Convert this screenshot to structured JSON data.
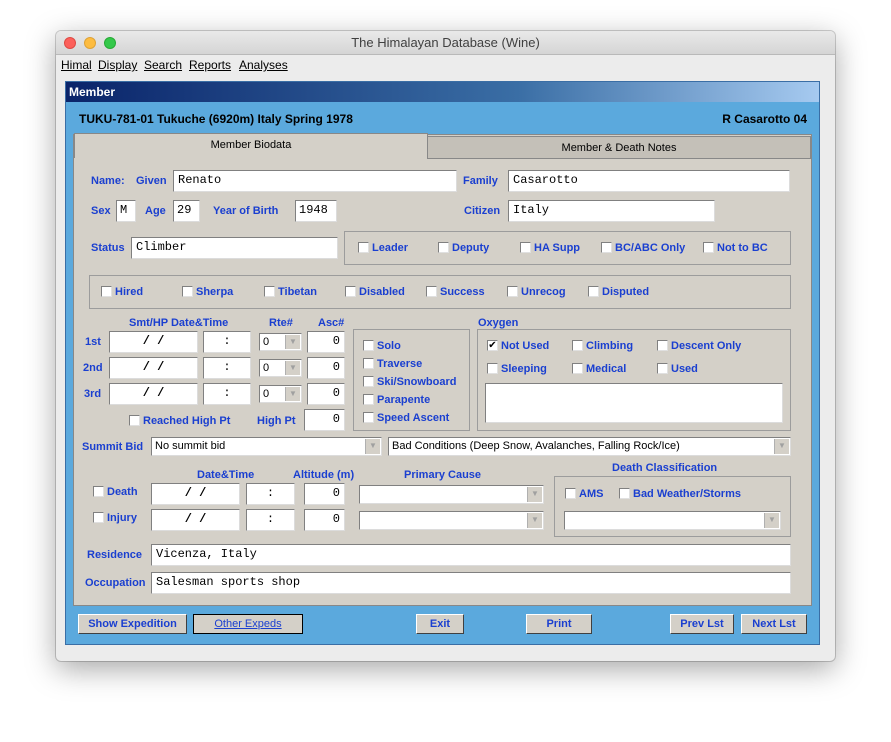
{
  "window": {
    "title": "The Himalayan Database  (Wine)"
  },
  "menu": [
    "Himal",
    "Display",
    "Search",
    "Reports",
    "Analyses"
  ],
  "member_window": {
    "caption": "Member",
    "expedition_info": "TUKU-781-01  Tukuche (6920m)    Italy   Spring 1978",
    "member_ref": "R Casarotto  04",
    "tabs": [
      "Member Biodata",
      "Member & Death Notes"
    ]
  },
  "biodata": {
    "name_label": "Name:",
    "given_label": "Given",
    "given": "Renato",
    "family_label": "Family",
    "family": "Casarotto",
    "sex_label": "Sex",
    "sex": "M",
    "age_label": "Age",
    "age": "29",
    "yob_label": "Year of Birth",
    "yob": "1948",
    "citizen_label": "Citizen",
    "citizen": "Italy",
    "status_label": "Status",
    "status": "Climber"
  },
  "roles": [
    {
      "label": "Leader",
      "checked": ""
    },
    {
      "label": "Deputy",
      "checked": ""
    },
    {
      "label": "HA Supp",
      "checked": ""
    },
    {
      "label": "BC/ABC Only",
      "checked": ""
    },
    {
      "label": "Not to BC",
      "checked": ""
    }
  ],
  "flags": [
    {
      "label": "Hired",
      "checked": ""
    },
    {
      "label": "Sherpa",
      "checked": ""
    },
    {
      "label": "Tibetan",
      "checked": ""
    },
    {
      "label": "Disabled",
      "checked": ""
    },
    {
      "label": "Success",
      "checked": ""
    },
    {
      "label": "Unrecog",
      "checked": ""
    },
    {
      "label": "Disputed",
      "checked": ""
    }
  ],
  "summits": {
    "header_date": "Smt/HP Date&Time",
    "header_rte": "Rte#",
    "header_asc": "Asc#",
    "rows": [
      {
        "label": "1st",
        "date": "  /  /",
        "time": ":",
        "rte": "0",
        "asc": "0"
      },
      {
        "label": "2nd",
        "date": "  /  /",
        "time": ":",
        "rte": "0",
        "asc": "0"
      },
      {
        "label": "3rd",
        "date": "  /  /",
        "time": ":",
        "rte": "0",
        "asc": "0"
      }
    ],
    "reached_high_pt": "Reached High Pt",
    "high_pt_label": "High Pt",
    "high_pt": "0"
  },
  "styles": [
    {
      "label": "Solo",
      "checked": ""
    },
    {
      "label": "Traverse",
      "checked": ""
    },
    {
      "label": "Ski/Snowboard",
      "checked": ""
    },
    {
      "label": "Parapente",
      "checked": ""
    },
    {
      "label": "Speed Ascent",
      "checked": ""
    }
  ],
  "oxygen": {
    "label": "Oxygen",
    "options": [
      {
        "label": "Not Used",
        "checked": "✔"
      },
      {
        "label": "Climbing",
        "checked": ""
      },
      {
        "label": "Descent Only",
        "checked": ""
      },
      {
        "label": "Sleeping",
        "checked": ""
      },
      {
        "label": "Medical",
        "checked": ""
      },
      {
        "label": "Used",
        "checked": ""
      }
    ],
    "notes": ""
  },
  "summit_bid": {
    "label": "Summit Bid",
    "value": "No summit bid",
    "reason": "Bad Conditions (Deep Snow, Avalanches, Falling Rock/Ice)"
  },
  "death_injury": {
    "date_label": "Date&Time",
    "altitude_label": "Altitude (m)",
    "cause_label": "Primary Cause",
    "rows": [
      {
        "label": "Death",
        "date": "  /  /",
        "time": ":",
        "altitude": "0",
        "cause": ""
      },
      {
        "label": "Injury",
        "date": "  /  /",
        "time": ":",
        "altitude": "0",
        "cause": ""
      }
    ],
    "classification_label": "Death Classification",
    "ams": "AMS",
    "bad_weather": "Bad Weather/Storms",
    "classification_value": ""
  },
  "residence": {
    "label": "Residence",
    "value": "Vicenza, Italy"
  },
  "occupation": {
    "label": "Occupation",
    "value": "Salesman sports shop"
  },
  "buttons": {
    "show_expedition": "Show Expedition",
    "other_expeds": "Other Expeds",
    "exit": "Exit",
    "print": "Print",
    "prev": "Prev Lst",
    "next": "Next Lst"
  },
  "colors": {
    "panel_blue": "#5ba9dd",
    "label_blue": "#1a3fd0",
    "dialog_gray": "#d4d0c8"
  }
}
